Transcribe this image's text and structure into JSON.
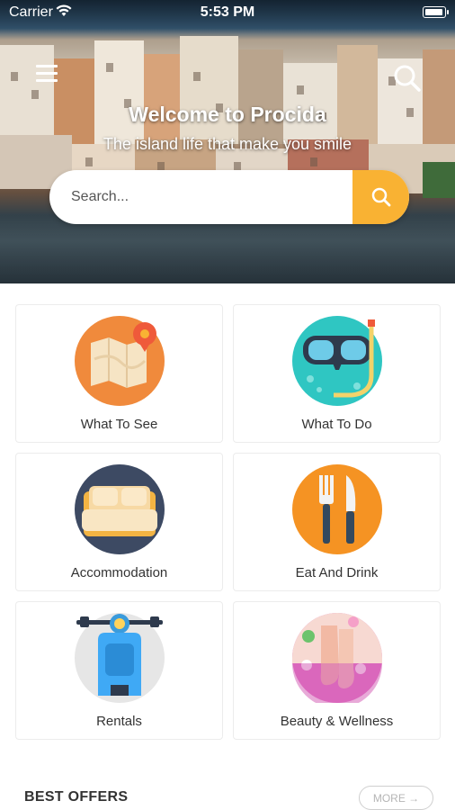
{
  "status_bar": {
    "carrier": "Carrier",
    "time": "5:53 PM"
  },
  "header": {
    "title": "Welcome to Procida",
    "subtitle": "The island life that make you smile"
  },
  "search": {
    "placeholder": "Search..."
  },
  "categories": [
    {
      "label": "What To See",
      "icon": "map-icon"
    },
    {
      "label": "What To Do",
      "icon": "diving-mask-icon"
    },
    {
      "label": "Accommodation",
      "icon": "bed-icon"
    },
    {
      "label": "Eat And Drink",
      "icon": "fork-knife-icon"
    },
    {
      "label": "Rentals",
      "icon": "scooter-icon"
    },
    {
      "label": "Beauty & Wellness",
      "icon": "spa-feet-icon"
    }
  ],
  "offers": {
    "title": "BEST OFFERS",
    "more_label": "MORE",
    "more_icon": "arrow-right-icon"
  },
  "colors": {
    "accent": "#f9b233",
    "text": "#333333"
  }
}
